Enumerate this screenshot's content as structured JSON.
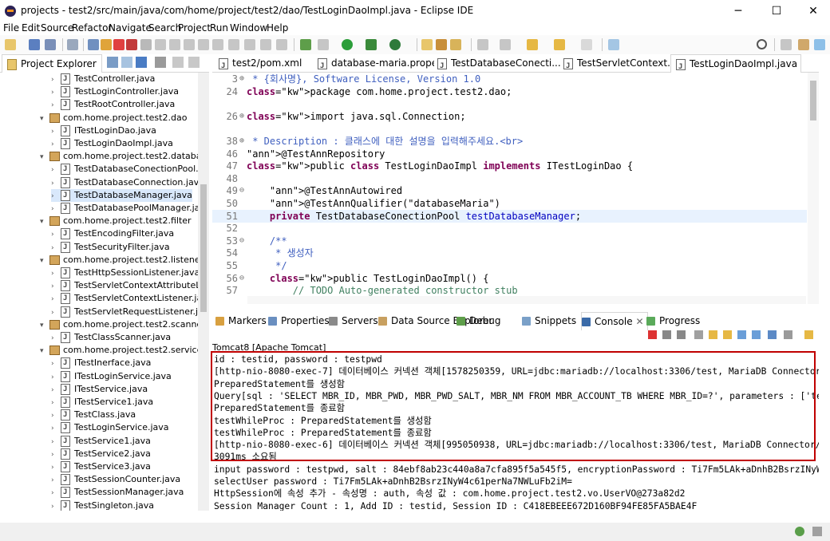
{
  "window": {
    "title": "projects - test2/src/main/java/com/home/project/test2/dao/TestLoginDaoImpl.java - Eclipse IDE",
    "minimize": "─",
    "maximize": "☐",
    "close": "✕"
  },
  "menu": [
    "File",
    "Edit",
    "Source",
    "Refactor",
    "Navigate",
    "Search",
    "Project",
    "Run",
    "Window",
    "Help"
  ],
  "explorer": {
    "title": "Project Explorer",
    "rows": [
      {
        "label": "TestController.java",
        "type": "file"
      },
      {
        "label": "TestLoginController.java",
        "type": "file"
      },
      {
        "label": "TestRootController.java",
        "type": "file"
      },
      {
        "label": "com.home.project.test2.dao",
        "type": "pkg"
      },
      {
        "label": "ITestLoginDao.java",
        "type": "file"
      },
      {
        "label": "TestLoginDaoImpl.java",
        "type": "file"
      },
      {
        "label": "com.home.project.test2.database",
        "type": "pkg"
      },
      {
        "label": "TestDatabaseConectionPool.java",
        "type": "file"
      },
      {
        "label": "TestDatabaseConnection.java",
        "type": "file"
      },
      {
        "label": "TestDatabaseManager.java",
        "type": "file",
        "selected": true
      },
      {
        "label": "TestDatabasePoolManager.java",
        "type": "file"
      },
      {
        "label": "com.home.project.test2.filter",
        "type": "pkg"
      },
      {
        "label": "TestEncodingFilter.java",
        "type": "file"
      },
      {
        "label": "TestSecurityFilter.java",
        "type": "file"
      },
      {
        "label": "com.home.project.test2.listener",
        "type": "pkg"
      },
      {
        "label": "TestHttpSessionListener.java",
        "type": "file"
      },
      {
        "label": "TestServletContextAttributeListe",
        "type": "file"
      },
      {
        "label": "TestServletContextListener.java",
        "type": "file"
      },
      {
        "label": "TestServletRequestListener.java",
        "type": "file"
      },
      {
        "label": "com.home.project.test2.scanner",
        "type": "pkg"
      },
      {
        "label": "TestClassScanner.java",
        "type": "file"
      },
      {
        "label": "com.home.project.test2.service",
        "type": "pkg"
      },
      {
        "label": "ITestInerface.java",
        "type": "file"
      },
      {
        "label": "ITestLoginService.java",
        "type": "file"
      },
      {
        "label": "ITestService.java",
        "type": "file"
      },
      {
        "label": "ITestService1.java",
        "type": "file"
      },
      {
        "label": "TestClass.java",
        "type": "file"
      },
      {
        "label": "TestLoginService.java",
        "type": "file"
      },
      {
        "label": "TestService1.java",
        "type": "file"
      },
      {
        "label": "TestService2.java",
        "type": "file"
      },
      {
        "label": "TestService3.java",
        "type": "file"
      },
      {
        "label": "TestSessionCounter.java",
        "type": "file"
      },
      {
        "label": "TestSessionManager.java",
        "type": "file"
      },
      {
        "label": "TestSingleton.java",
        "type": "file"
      }
    ]
  },
  "editor_tabs": [
    {
      "label": "test2/pom.xml"
    },
    {
      "label": "database-maria.prope..."
    },
    {
      "label": "TestDatabaseConecti..."
    },
    {
      "label": "TestServletContext..."
    },
    {
      "label": "TestLoginDaoImpl.java",
      "active": true
    }
  ],
  "code": [
    {
      "ln": "3",
      "fold": "⊕",
      "text": " * {회사명}, Software License, Version 1.0",
      "cls": "cm"
    },
    {
      "ln": "24",
      "fold": "",
      "text": "package com.home.project.test2.dao;",
      "cls": ""
    },
    {
      "ln": "",
      "fold": "",
      "text": "",
      "cls": ""
    },
    {
      "ln": "26",
      "fold": "⊕",
      "text": "import java.sql.Connection;",
      "cls": ""
    },
    {
      "ln": "",
      "fold": "",
      "text": "",
      "cls": ""
    },
    {
      "ln": "38",
      "fold": "⊕",
      "text": " * Description : 클래스에 대한 설명을 입력해주세요.<br>",
      "cls": "cm"
    },
    {
      "ln": "46",
      "fold": "",
      "text": "@TestAnnRepository",
      "cls": "ann"
    },
    {
      "ln": "47",
      "fold": "",
      "text": "public class TestLoginDaoImpl implements ITestLoginDao {",
      "cls": ""
    },
    {
      "ln": "48",
      "fold": "",
      "text": "",
      "cls": ""
    },
    {
      "ln": "49",
      "fold": "⊖",
      "text": "    @TestAnnAutowired",
      "cls": "ann"
    },
    {
      "ln": "50",
      "fold": "",
      "text": "    @TestAnnQualifier(\"databaseMaria\")",
      "cls": "ann"
    },
    {
      "ln": "51",
      "fold": "",
      "text": "    private TestDatabaseConectionPool testDatabaseManager;",
      "cls": "",
      "hl": true
    },
    {
      "ln": "52",
      "fold": "",
      "text": "",
      "cls": ""
    },
    {
      "ln": "53",
      "fold": "⊖",
      "text": "    /**",
      "cls": "cm"
    },
    {
      "ln": "54",
      "fold": "",
      "text": "     * 생성자",
      "cls": "cm"
    },
    {
      "ln": "55",
      "fold": "",
      "text": "     */",
      "cls": "cm"
    },
    {
      "ln": "56",
      "fold": "⊖",
      "text": "    public TestLoginDaoImpl() {",
      "cls": ""
    },
    {
      "ln": "57",
      "fold": "",
      "text": "        // TODO Auto-generated constructor stub",
      "cls": "tcm"
    }
  ],
  "bottom_tabs": [
    "Markers",
    "Properties",
    "Servers",
    "Data Source Explorer",
    "Debug",
    "Snippets",
    "Console",
    "Progress"
  ],
  "console": {
    "header": "Tomcat8 [Apache Tomcat]",
    "lines": [
      "id : testid, password : testpwd",
      "[http-nio-8080-exec-7] 데이터베이스 커넥션 객체[1578250359, URL=jdbc:mariadb://localhost:3306/test, MariaDB Connector/",
      "PreparedStatement를 생성함",
      "Query[sql : 'SELECT MBR_ID, MBR_PWD, MBR_PWD_SALT, MBR_NM FROM MBR_ACCOUNT_TB WHERE MBR_ID=?', parameters : ['te",
      "PreparedStatement를 종료함",
      "testWhileProc : PreparedStatement를 생성함",
      "testWhileProc : PreparedStatement를 종료함",
      "[http-nio-8080-exec-6] 데이터베이스 커넥션 객체[995050938, URL=jdbc:mariadb://localhost:3306/test, MariaDB Connector/J",
      "3091ms 소요됨",
      "input password : testpwd, salt : 84ebf8ab23c440a8a7cfa895f5a545f5, encryptionPassword : Ti7Fm5LAk+aDnhB2BsrzINyW",
      "selectUser password : Ti7Fm5LAk+aDnhB2BsrzINyW4c61perNa7NWLuFb2iM=",
      "HttpSession에 속성 추가 - 속성명 : auth, 속성 값 : com.home.project.test2.vo.UserVO@273a82d2",
      "Session Manager Count : 1, Add ID : testid, Session ID : C418EBEEE672D160BF94FE85FA5BAE4F"
    ]
  }
}
